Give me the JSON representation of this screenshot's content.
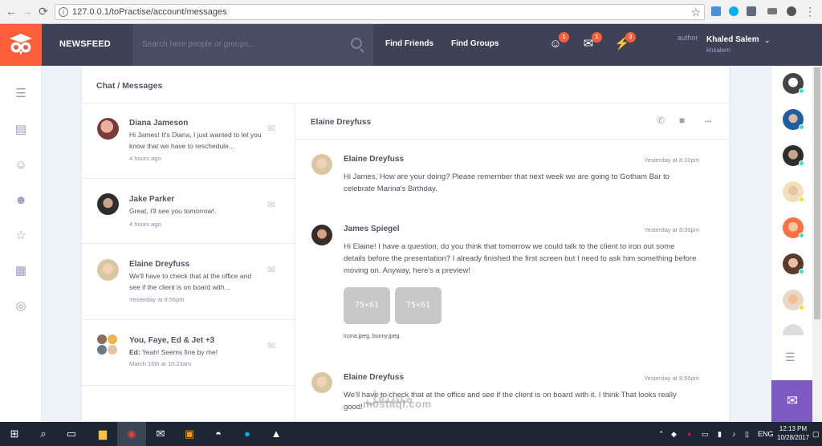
{
  "browser": {
    "url": "127.0.0.1/toPractise/account/messages",
    "back_glyph": "←",
    "forward_glyph": "→",
    "reload_glyph": "⟳",
    "info_glyph": "i",
    "star_glyph": "☆",
    "menu_glyph": "⋮"
  },
  "header": {
    "brand": "NEWSFEED",
    "search_placeholder": "Search here people or groups...",
    "links": [
      "Find Friends",
      "Find Groups"
    ],
    "notifications": [
      {
        "name": "friend-requests",
        "count": "1",
        "glyph": "☺"
      },
      {
        "name": "messages",
        "count": "1",
        "glyph": "✉"
      },
      {
        "name": "alerts",
        "count": "3",
        "glyph": "⚡"
      }
    ],
    "author_alt": "author",
    "user_name": "Khaled Salem",
    "user_handle": "khsalem",
    "caret": "⌄"
  },
  "left_sidebar": {
    "glyphs": [
      "☰",
      "▤",
      "☺",
      "☻",
      "☆",
      "▦",
      "◎"
    ]
  },
  "right_sidebar": {
    "list_glyph": "☰",
    "chat_glyph": "✉"
  },
  "main": {
    "breadcrumb": "Chat / Messages",
    "conversations": [
      {
        "name": "Diana Jameson",
        "message": "Hi James! It's Diana, I just wanted to let you know that we have to reschedule...",
        "time": "4 hours ago"
      },
      {
        "name": "Jake Parker",
        "message": "Great, I'll see you tomorrow!.",
        "time": "4 hours ago"
      },
      {
        "name": "Elaine Dreyfuss",
        "message": "We'll have to check that at the office and see if the client is on board with...",
        "time": "Yesterday at 9:56pm"
      },
      {
        "name": "You, Faye, Ed & Jet +3",
        "sender": "Ed:",
        "message": "Yeah! Seems fine by me!",
        "time": "March 16th at 10:23am"
      }
    ],
    "chat": {
      "title": "Elaine Dreyfuss",
      "phone_glyph": "✆",
      "video_glyph": "■",
      "more_glyph": "•••",
      "messages": [
        {
          "name": "Elaine Dreyfuss",
          "time": "Yesterday at 8:10pm",
          "text": "Hi James, How are your doing? Please remember that next week we are going to Gotham Bar to celebrate Marina's Birthday."
        },
        {
          "name": "James Spiegel",
          "time": "Yesterday at 8:30pm",
          "text": "Hi Elaine! I have a question, do you think that tomorrow we could talk to the client to iron out some details before the presentation? I already finished the first screen but I need to ask him something before moving on. Anyway, here's a preview!",
          "thumbs": [
            "75×61",
            "75×61"
          ],
          "attachments": "icona.jpeg, bunny.jpeg"
        },
        {
          "name": "Elaine Dreyfuss",
          "time": "Yesterday at 9:56pm",
          "text": "We'll have to check that at the office and see if the client is on board with it. I think That looks really good!"
        }
      ]
    }
  },
  "taskbar": {
    "lang": "ENG",
    "time": "12:13 PM",
    "date": "10/28/2017"
  },
  "watermark": {
    "arabic": "مستقل",
    "latin": "mostaql.com"
  },
  "colors": {
    "header_bg": "#3f4257",
    "accent_orange": "#ff5e3a",
    "accent_purple": "#7c5ac2",
    "online_dot": "#32e4cd"
  }
}
